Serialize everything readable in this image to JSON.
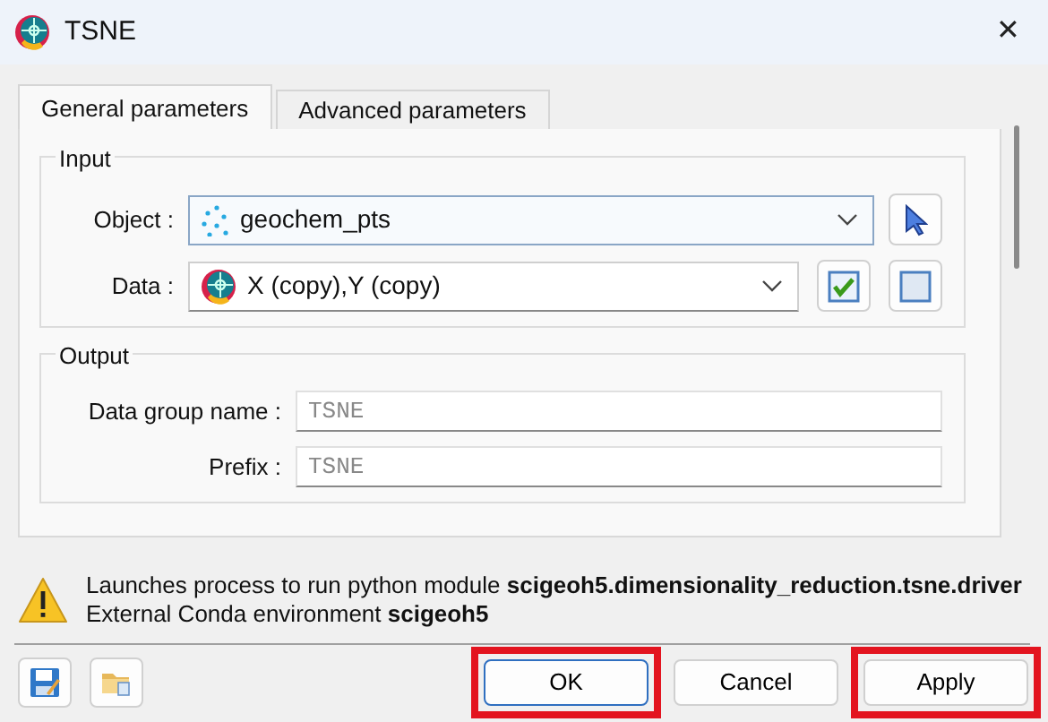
{
  "window": {
    "title": "TSNE",
    "close": "✕"
  },
  "tabs": [
    {
      "label": "General parameters",
      "selected": true
    },
    {
      "label": "Advanced parameters",
      "selected": false
    }
  ],
  "input": {
    "title": "Input",
    "object": {
      "label": "Object :",
      "value": "geochem_pts"
    },
    "data": {
      "label": "Data :",
      "value": "X (copy),Y (copy)"
    }
  },
  "output": {
    "title": "Output",
    "fields": [
      {
        "label": "Data group name :",
        "placeholder": "TSNE"
      },
      {
        "label": "Prefix :",
        "placeholder": "TSNE"
      }
    ]
  },
  "message": [
    "Launches process to run python module **scigeoh5.dimensionality_reduction.tsne.driver**",
    "External Conda environment **scigeoh5**"
  ],
  "buttons": [
    {
      "label": "OK",
      "highlighted": true,
      "default": true
    },
    {
      "label": "Cancel",
      "highlighted": false,
      "default": false
    },
    {
      "label": "Apply",
      "highlighted": true,
      "default": false
    }
  ]
}
